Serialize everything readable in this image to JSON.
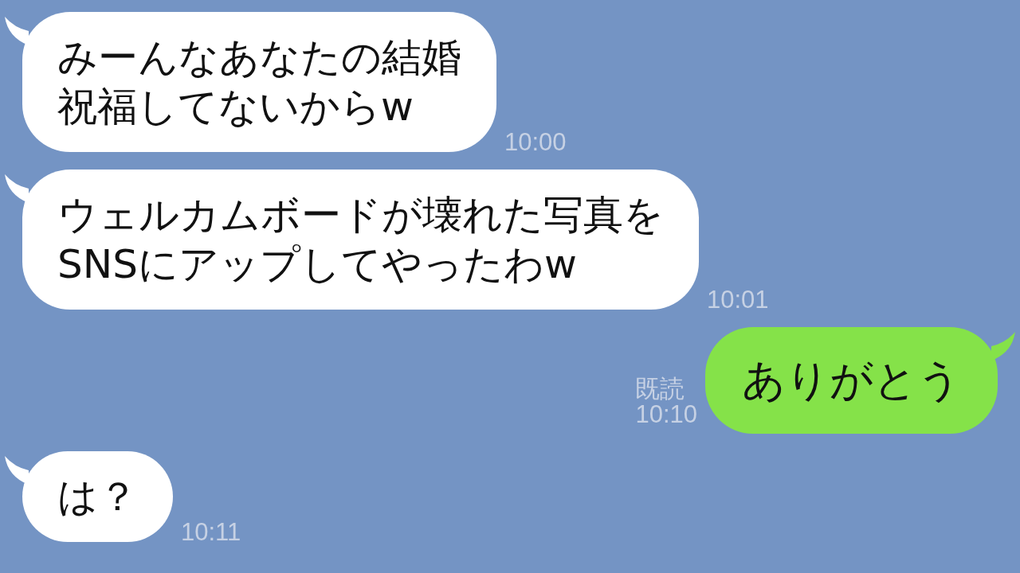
{
  "messages": [
    {
      "kind": "incoming",
      "lines": [
        "みーんなあなたの結婚",
        "祝福してないからw"
      ],
      "time": "10:00"
    },
    {
      "kind": "incoming",
      "lines": [
        "ウェルカムボードが壊れた写真を",
        "SNSにアップしてやったわw"
      ],
      "time": "10:01"
    },
    {
      "kind": "outgoing",
      "lines": [
        "ありがとう"
      ],
      "read": "既読",
      "time": "10:10"
    },
    {
      "kind": "incoming",
      "lines": [
        "は？"
      ],
      "time": "10:11"
    }
  ]
}
